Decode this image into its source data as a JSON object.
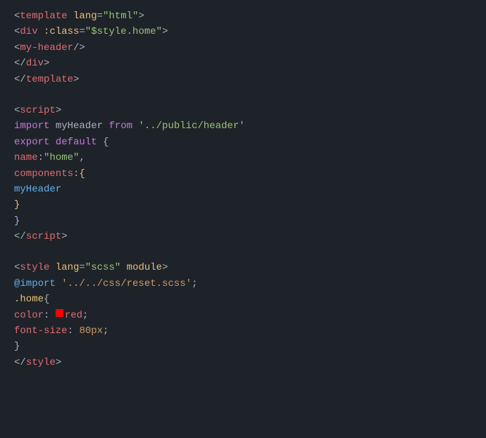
{
  "lines": [
    {
      "id": "l1",
      "tokens": [
        {
          "text": "<",
          "color": "c-gray"
        },
        {
          "text": "template",
          "color": "c-red"
        },
        {
          "text": " lang",
          "color": "c-yellow"
        },
        {
          "text": "=",
          "color": "c-gray"
        },
        {
          "text": "\"html\"",
          "color": "c-green"
        },
        {
          "text": ">",
          "color": "c-gray"
        }
      ]
    },
    {
      "id": "l2",
      "indent": 1,
      "tokens": [
        {
          "text": "<",
          "color": "c-gray"
        },
        {
          "text": "div",
          "color": "c-red"
        },
        {
          "text": " :class",
          "color": "c-yellow"
        },
        {
          "text": "=",
          "color": "c-gray"
        },
        {
          "text": "\"$style.home\"",
          "color": "c-green"
        },
        {
          "text": ">",
          "color": "c-gray"
        }
      ]
    },
    {
      "id": "l3",
      "indent": 2,
      "tokens": [
        {
          "text": "<",
          "color": "c-gray"
        },
        {
          "text": "my-header",
          "color": "c-red"
        },
        {
          "text": "/>",
          "color": "c-gray"
        }
      ]
    },
    {
      "id": "l4",
      "indent": 1,
      "tokens": [
        {
          "text": "</",
          "color": "c-gray"
        },
        {
          "text": "div",
          "color": "c-red"
        },
        {
          "text": ">",
          "color": "c-gray"
        }
      ]
    },
    {
      "id": "l5",
      "tokens": [
        {
          "text": "</",
          "color": "c-gray"
        },
        {
          "text": "template",
          "color": "c-red"
        },
        {
          "text": ">",
          "color": "c-gray"
        }
      ]
    },
    {
      "id": "l6",
      "empty": true
    },
    {
      "id": "l7",
      "tokens": [
        {
          "text": "<",
          "color": "c-gray"
        },
        {
          "text": "script",
          "color": "c-red"
        },
        {
          "text": ">",
          "color": "c-gray"
        }
      ]
    },
    {
      "id": "l8",
      "tokens": [
        {
          "text": "import",
          "color": "c-purple"
        },
        {
          "text": " myHeader ",
          "color": "c-text"
        },
        {
          "text": "from",
          "color": "c-purple"
        },
        {
          "text": " ",
          "color": "c-text"
        },
        {
          "text": "'../public/header'",
          "color": "c-green"
        }
      ]
    },
    {
      "id": "l9",
      "tokens": [
        {
          "text": "export",
          "color": "c-purple"
        },
        {
          "text": " ",
          "color": "c-text"
        },
        {
          "text": "default",
          "color": "c-purple"
        },
        {
          "text": " {",
          "color": "c-text"
        }
      ]
    },
    {
      "id": "l10",
      "indent": 1,
      "tokens": [
        {
          "text": "name",
          "color": "c-red"
        },
        {
          "text": ":",
          "color": "c-text"
        },
        {
          "text": "\"home\"",
          "color": "c-green"
        },
        {
          "text": ",",
          "color": "c-text"
        }
      ]
    },
    {
      "id": "l11",
      "indent": 1,
      "tokens": [
        {
          "text": "components",
          "color": "c-red"
        },
        {
          "text": ":",
          "color": "c-text"
        },
        {
          "text": "{",
          "color": "c-yellow"
        }
      ]
    },
    {
      "id": "l12",
      "indent": 2,
      "tokens": [
        {
          "text": "myHeader",
          "color": "c-blue"
        }
      ]
    },
    {
      "id": "l13",
      "indent": 1,
      "tokens": [
        {
          "text": "}",
          "color": "c-yellow"
        }
      ]
    },
    {
      "id": "l14",
      "tokens": [
        {
          "text": "}",
          "color": "c-text"
        }
      ]
    },
    {
      "id": "l15",
      "tokens": [
        {
          "text": "</",
          "color": "c-gray"
        },
        {
          "text": "script",
          "color": "c-red"
        },
        {
          "text": ">",
          "color": "c-gray"
        }
      ]
    },
    {
      "id": "l16",
      "empty": true
    },
    {
      "id": "l17",
      "tokens": [
        {
          "text": "<",
          "color": "c-gray"
        },
        {
          "text": "style",
          "color": "c-red"
        },
        {
          "text": " lang",
          "color": "c-yellow"
        },
        {
          "text": "=",
          "color": "c-gray"
        },
        {
          "text": "\"scss\"",
          "color": "c-green"
        },
        {
          "text": " module",
          "color": "c-yellow"
        },
        {
          "text": ">",
          "color": "c-gray"
        }
      ]
    },
    {
      "id": "l18",
      "indent": 1,
      "tokens": [
        {
          "text": "@import",
          "color": "c-blue"
        },
        {
          "text": " ",
          "color": "c-text"
        },
        {
          "text": "'../../css/reset.scss'",
          "color": "c-orange"
        },
        {
          "text": ";",
          "color": "c-text"
        }
      ]
    },
    {
      "id": "l19",
      "indent": 1,
      "tokens": [
        {
          "text": ".home",
          "color": "c-yellow"
        },
        {
          "text": "{",
          "color": "c-text"
        }
      ]
    },
    {
      "id": "l20",
      "indent": 2,
      "tokens": [
        {
          "text": "color",
          "color": "c-red"
        },
        {
          "text": ": ",
          "color": "c-text"
        },
        {
          "text": "SWATCH",
          "color": "c-swatch"
        },
        {
          "text": "red",
          "color": "c-red"
        },
        {
          "text": ";",
          "color": "c-text"
        }
      ]
    },
    {
      "id": "l21",
      "indent": 2,
      "tokens": [
        {
          "text": "font-size",
          "color": "c-red"
        },
        {
          "text": ": ",
          "color": "c-text"
        },
        {
          "text": "80px",
          "color": "c-orange"
        },
        {
          "text": ";",
          "color": "c-text"
        }
      ]
    },
    {
      "id": "l22",
      "indent": 1,
      "tokens": [
        {
          "text": "}",
          "color": "c-text"
        }
      ]
    },
    {
      "id": "l23",
      "tokens": [
        {
          "text": "</",
          "color": "c-gray"
        },
        {
          "text": "style",
          "color": "c-red"
        },
        {
          "text": ">",
          "color": "c-gray"
        }
      ]
    }
  ]
}
